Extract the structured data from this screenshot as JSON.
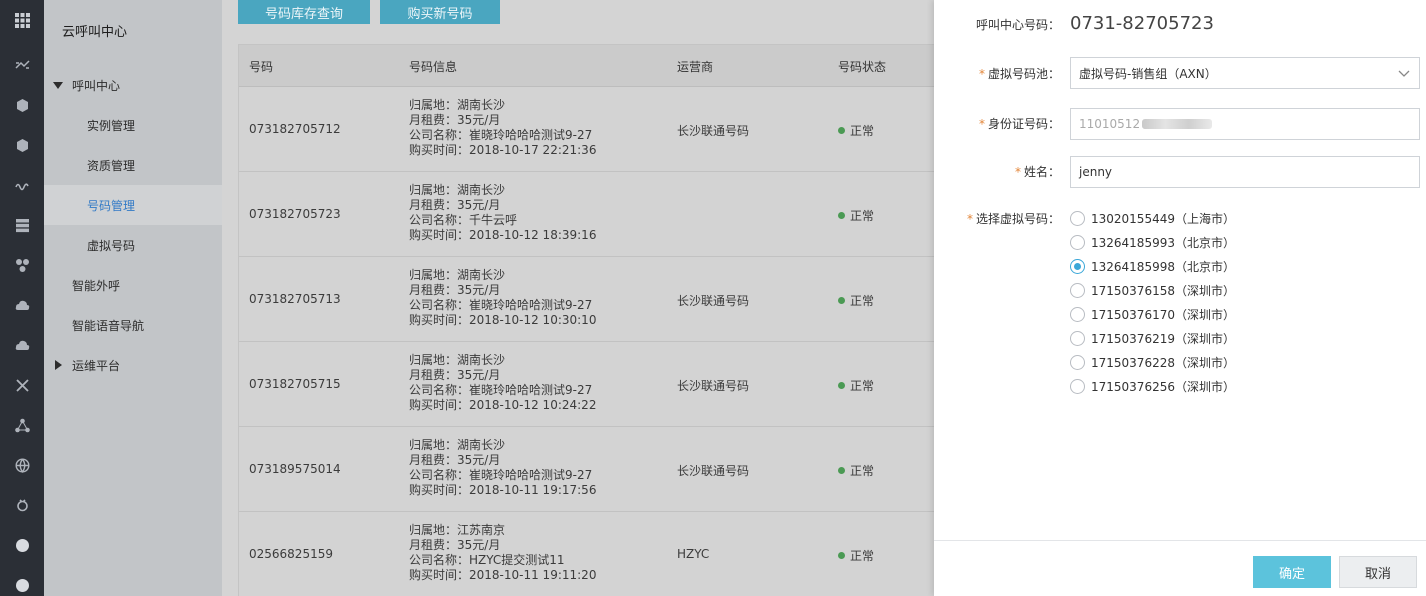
{
  "rail": {
    "icons": [
      "grid-icon",
      "transfer-icon",
      "cube-icon",
      "cube-icon",
      "wave-icon",
      "server-icon",
      "cluster-icon",
      "cloud-icon",
      "cloud-upload-icon",
      "cross-icon",
      "network-icon",
      "globe-icon",
      "gear-icon",
      "circle-icon",
      "circle-icon"
    ]
  },
  "nav": {
    "app_title": "云呼叫中心",
    "items": [
      {
        "label": "呼叫中心"
      },
      {
        "label": "实例管理"
      },
      {
        "label": "资质管理"
      },
      {
        "label": "号码管理"
      },
      {
        "label": "虚拟号码"
      },
      {
        "label": "智能外呼"
      },
      {
        "label": "智能语音导航"
      },
      {
        "label": "运维平台"
      }
    ],
    "active": "号码管理"
  },
  "toolbar": {
    "query_label": "号码库存查询",
    "buy_label": "购买新号码"
  },
  "table": {
    "headers": [
      "号码",
      "号码信息",
      "运营商",
      "号码状态"
    ],
    "rows": [
      {
        "number": "073182705712",
        "info": [
          "归属地：湖南长沙",
          "月租费：35元/月",
          "公司名称：崔晓玲哈哈哈测试9-27",
          "购买时间：2018-10-17 22:21:36"
        ],
        "operator": "长沙联通号码",
        "status": "正常"
      },
      {
        "number": "073182705723",
        "info": [
          "归属地：湖南长沙",
          "月租费：35元/月",
          "公司名称：千牛云呼",
          "购买时间：2018-10-12 18:39:16"
        ],
        "operator": "",
        "status": "正常"
      },
      {
        "number": "073182705713",
        "info": [
          "归属地：湖南长沙",
          "月租费：35元/月",
          "公司名称：崔晓玲哈哈哈测试9-27",
          "购买时间：2018-10-12 10:30:10"
        ],
        "operator": "长沙联通号码",
        "status": "正常"
      },
      {
        "number": "073182705715",
        "info": [
          "归属地：湖南长沙",
          "月租费：35元/月",
          "公司名称：崔晓玲哈哈哈测试9-27",
          "购买时间：2018-10-12 10:24:22"
        ],
        "operator": "长沙联通号码",
        "status": "正常"
      },
      {
        "number": "073189575014",
        "info": [
          "归属地：湖南长沙",
          "月租费：35元/月",
          "公司名称：崔晓玲哈哈哈测试9-27",
          "购买时间：2018-10-11 19:17:56"
        ],
        "operator": "长沙联通号码",
        "status": "正常"
      },
      {
        "number": "02566825159",
        "info": [
          "归属地：江苏南京",
          "月租费：35元/月",
          "公司名称：HZYC提交测试11",
          "购买时间：2018-10-11 19:11:20"
        ],
        "operator": "HZYC",
        "status": "正常"
      }
    ]
  },
  "panel": {
    "center_label": "呼叫中心号码：",
    "center_number": "0731-82705723",
    "pool_label": "虚拟号码池：",
    "pool_value": "虚拟号码-销售组（AXN）",
    "id_label": "身份证号码：",
    "id_value": "11010512",
    "name_label": "姓名：",
    "name_value": "jenny",
    "pick_label": "选择虚拟号码：",
    "options": [
      {
        "label": "13020155449（上海市）",
        "checked": false
      },
      {
        "label": "13264185993（北京市）",
        "checked": false
      },
      {
        "label": "13264185998（北京市）",
        "checked": true
      },
      {
        "label": "17150376158（深圳市）",
        "checked": false
      },
      {
        "label": "17150376170（深圳市）",
        "checked": false
      },
      {
        "label": "17150376219（深圳市）",
        "checked": false
      },
      {
        "label": "17150376228（深圳市）",
        "checked": false
      },
      {
        "label": "17150376256（深圳市）",
        "checked": false
      }
    ],
    "ok_label": "确定",
    "cancel_label": "取消",
    "required_mark": "*"
  }
}
